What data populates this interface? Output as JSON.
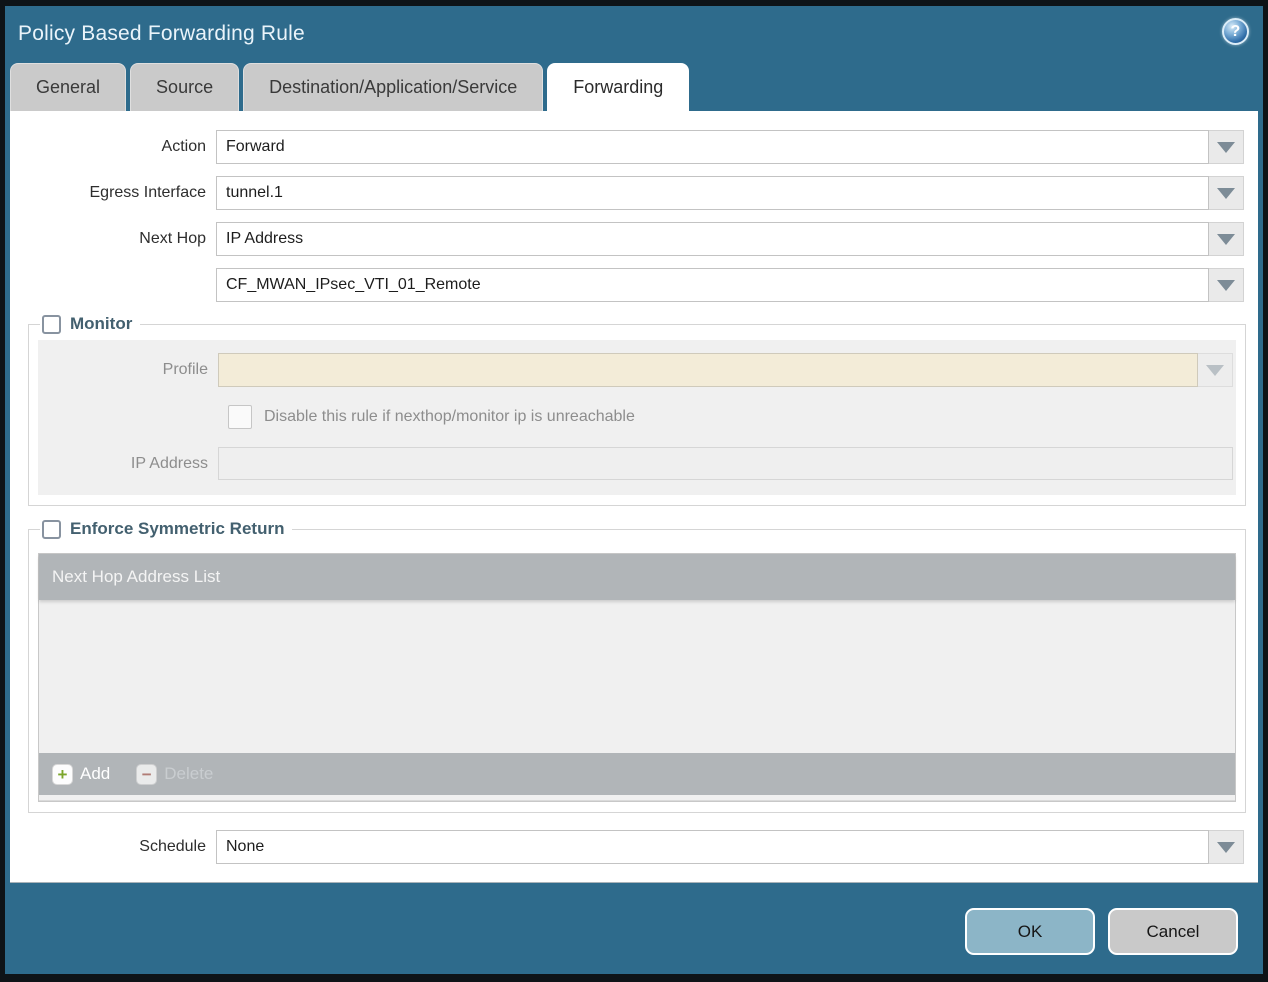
{
  "dialog": {
    "title": "Policy Based Forwarding Rule",
    "accent_color": "#2e6b8c",
    "help_glyph": "?"
  },
  "tabs": [
    {
      "label": "General",
      "active": false
    },
    {
      "label": "Source",
      "active": false
    },
    {
      "label": "Destination/Application/Service",
      "active": false
    },
    {
      "label": "Forwarding",
      "active": true
    }
  ],
  "form": {
    "action": {
      "label": "Action",
      "value": "Forward"
    },
    "egress_interface": {
      "label": "Egress Interface",
      "value": "tunnel.1"
    },
    "next_hop": {
      "label": "Next Hop",
      "value": "IP Address"
    },
    "next_hop_address": {
      "value": "CF_MWAN_IPsec_VTI_01_Remote"
    },
    "schedule": {
      "label": "Schedule",
      "value": "None"
    }
  },
  "monitor": {
    "title": "Monitor",
    "checked": false,
    "profile": {
      "label": "Profile",
      "value": ""
    },
    "disable_rule": {
      "label": "Disable this rule if nexthop/monitor ip is unreachable",
      "checked": false
    },
    "ip_address": {
      "label": "IP Address",
      "value": ""
    }
  },
  "enforce_symmetric_return": {
    "title": "Enforce Symmetric Return",
    "checked": false,
    "table": {
      "header": "Next Hop Address List",
      "rows": [],
      "add_label": "Add",
      "delete_label": "Delete"
    }
  },
  "footer": {
    "ok_label": "OK",
    "cancel_label": "Cancel"
  }
}
